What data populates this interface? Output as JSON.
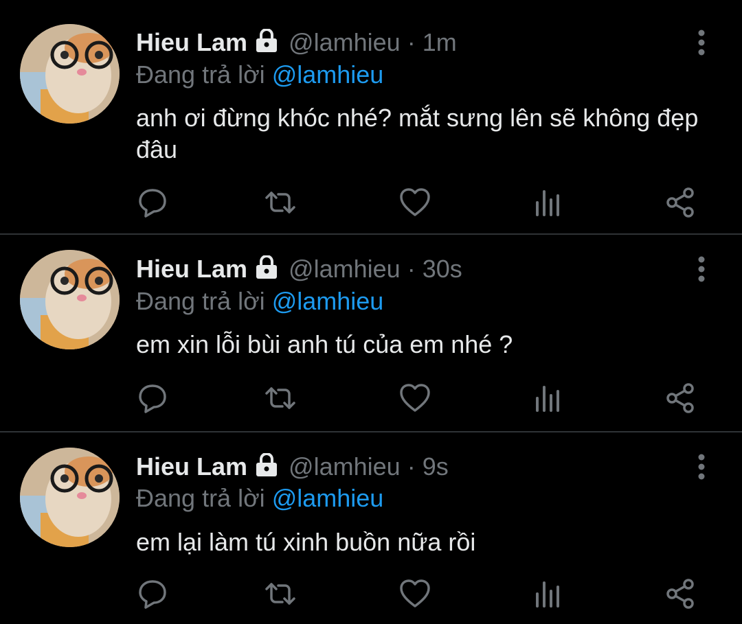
{
  "tweets": [
    {
      "name": "Hieu Lam",
      "handle": "@lamhieu",
      "dot": "·",
      "time": "1m",
      "reply_prefix": "Đang trả lời",
      "reply_to": "@lamhieu",
      "text": "anh ơi đừng khóc nhé? mắt sưng lên sẽ không đẹp đâu",
      "icons": [
        "lock-icon",
        "more-vertical-icon",
        "reply-icon",
        "retweet-icon",
        "like-icon",
        "analytics-icon",
        "share-icon"
      ]
    },
    {
      "name": "Hieu Lam",
      "handle": "@lamhieu",
      "dot": "·",
      "time": "30s",
      "reply_prefix": "Đang trả lời",
      "reply_to": "@lamhieu",
      "text": "em xin lỗi bùi anh tú của em nhé ?",
      "icons": [
        "lock-icon",
        "more-vertical-icon",
        "reply-icon",
        "retweet-icon",
        "like-icon",
        "analytics-icon",
        "share-icon"
      ]
    },
    {
      "name": "Hieu Lam",
      "handle": "@lamhieu",
      "dot": "·",
      "time": "9s",
      "reply_prefix": "Đang trả lời",
      "reply_to": "@lamhieu",
      "text": "em lại làm tú xinh buồn nữa rồi",
      "icons": [
        "lock-icon",
        "more-vertical-icon",
        "reply-icon",
        "retweet-icon",
        "like-icon",
        "analytics-icon",
        "share-icon"
      ]
    }
  ],
  "colors": {
    "background": "#000000",
    "text": "#e7e9ea",
    "secondary": "#71767b",
    "accent": "#1d9bf0",
    "divider": "#2f3336"
  }
}
